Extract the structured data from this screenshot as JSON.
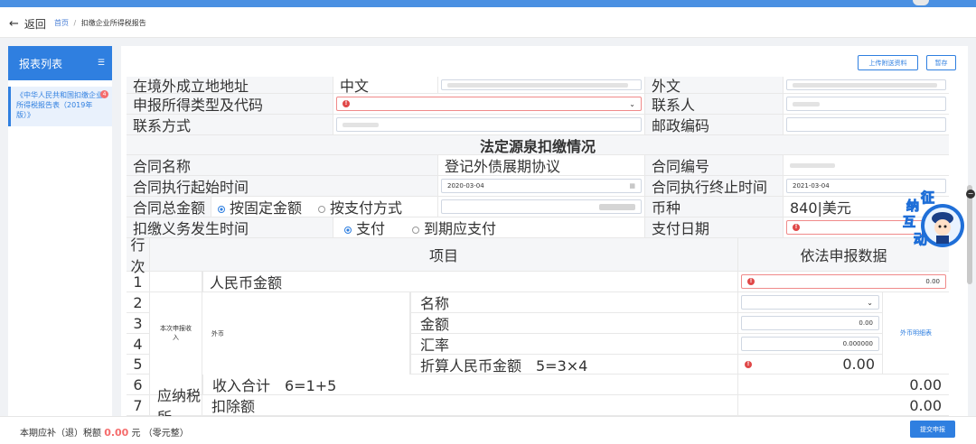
{
  "header": {
    "back_label": "返回",
    "breadcrumb_home": "首页",
    "breadcrumb_sep": "/",
    "breadcrumb_current": "扣缴企业所得税报告"
  },
  "sidebar": {
    "title": "报表列表",
    "item_label": "《中华人民共和国扣缴企业所得税报告表（2019年版）》",
    "item_badge": "4"
  },
  "toolbar": {
    "upload_label": "上传附送资料",
    "save_label": "暂存"
  },
  "form": {
    "r1": {
      "l1": "在境外成立地地址",
      "l2": "中文",
      "l3": "外文"
    },
    "r2": {
      "l1": "申报所得类型及代码",
      "l3": "联系人"
    },
    "r3": {
      "l1": "联系方式",
      "l3": "邮政编码"
    },
    "section_title": "法定源泉扣缴情况",
    "r5": {
      "l1": "合同名称",
      "l2": "登记外债展期协议",
      "l3": "合同编号"
    },
    "r6": {
      "l1": "合同执行起始时间",
      "v1": "2020-03-04",
      "l3": "合同执行终止时间",
      "v3": "2021-03-04"
    },
    "r7": {
      "l1": "合同总金额",
      "opt1": "按固定金额",
      "opt2": "按支付方式",
      "l3": "币种",
      "v3": "840|美元"
    },
    "r8": {
      "l1": "扣缴义务发生时间",
      "opt1": "支付",
      "opt2": "到期应支付",
      "l3": "支付日期"
    }
  },
  "table": {
    "head_rownum": "行次",
    "head_item": "项目",
    "head_value": "依法申报数据",
    "group_income": "本次申报收入",
    "group_next": "应纳税所",
    "rows": [
      {
        "n": "1",
        "label": "人民币金额",
        "value": "0.00"
      },
      {
        "n": "2",
        "label": "名称",
        "value": ""
      },
      {
        "n": "3",
        "label": "金额",
        "value": "0.00"
      },
      {
        "n": "4",
        "label": "汇率",
        "value": "0.000000"
      },
      {
        "n": "5",
        "label": "折算人民币金额　5=3×4",
        "value": "0.00"
      },
      {
        "n": "6",
        "label": "收入合计　6=1+5",
        "value": "0.00"
      },
      {
        "n": "7",
        "label": "扣除额",
        "value": "0.00"
      }
    ],
    "foreign_label": "外币",
    "foreign_link": "外币明细表"
  },
  "footer": {
    "prefix": "本期应补（退）税额",
    "amount": "0.00",
    "unit": "元",
    "words": "（零元整）",
    "submit_label": "提交申报"
  },
  "mascot": {
    "chars": [
      "征",
      "纳",
      "互",
      "动"
    ]
  },
  "colors": {
    "accent": "#2f7fe0",
    "error": "#e04848",
    "amount": "#f56c6c"
  }
}
